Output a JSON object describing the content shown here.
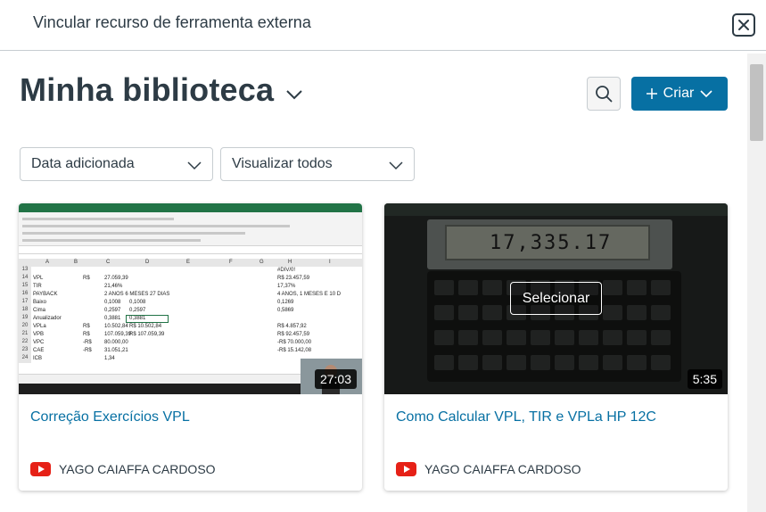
{
  "modal": {
    "title": "Vincular recurso de ferramenta externa",
    "close_icon": "close-icon"
  },
  "library": {
    "title": "Minha biblioteca",
    "chevron_icon": "chevron-down-icon"
  },
  "toolbar": {
    "search_icon": "search-icon",
    "create_label": "Criar",
    "create_icon": "plus-icon"
  },
  "filters": {
    "sort_selected": "Data adicionada",
    "view_selected": "Visualizar todos"
  },
  "colors": {
    "accent": "#0770a3",
    "text": "#2d3b45",
    "youtube": "#e62117"
  },
  "videos": [
    {
      "title": "Correção Exercícios VPL",
      "duration": "27:03",
      "channel": "YAGO CAIAFFA CARDOSO",
      "channel_icon": "youtube-icon",
      "thumbnail": {
        "rows": [
          {
            "n": "13",
            "a": "",
            "b": "",
            "c": "",
            "d": "",
            "h": "#DIV/0!"
          },
          {
            "n": "14",
            "a": "VPL",
            "b": "R$",
            "c": "27.059,39",
            "d": "",
            "h": "R$ 23.457,59"
          },
          {
            "n": "15",
            "a": "TIR",
            "b": "",
            "c": "21,46%",
            "d": "",
            "h": "17,37%"
          },
          {
            "n": "16",
            "a": "PAYBACK",
            "b": "",
            "c": "2 ANOS 6 MESES 27 DIAS",
            "d": "",
            "h": "4 ANOS, 1 MESES E 10 D"
          },
          {
            "n": "17",
            "a": "Baixo",
            "b": "",
            "c": "0,1008",
            "d": "0,1008",
            "h": "0,1269"
          },
          {
            "n": "18",
            "a": "Cima",
            "b": "",
            "c": "0,2597",
            "d": "0,2597",
            "h": "0,5869"
          },
          {
            "n": "19",
            "a": "Anualizador",
            "b": "",
            "c": "0,3881",
            "d": "0,3881",
            "h": ""
          },
          {
            "n": "20",
            "a": "VPLa",
            "b": "R$",
            "c": "10.502,84",
            "d": "R$ 10.502,84",
            "h": "R$ 4.857,92"
          },
          {
            "n": "21",
            "a": "VPB",
            "b": "R$",
            "c": "107.059,39",
            "d": "R$ 107.059,39",
            "h": "R$ 92.457,59"
          },
          {
            "n": "22",
            "a": "VPC",
            "b": "-R$",
            "c": "80.000,00",
            "d": "",
            "h": "-R$ 70.000,00"
          },
          {
            "n": "23",
            "a": "CAE",
            "b": "-R$",
            "c": "31.051,21",
            "d": "",
            "h": "-R$ 15.142,08"
          },
          {
            "n": "24",
            "a": "ICB",
            "b": "",
            "c": "1,34",
            "d": "",
            "h": ""
          }
        ],
        "columns": [
          "A",
          "B",
          "C",
          "D",
          "E",
          "F",
          "G",
          "H",
          "I"
        ]
      }
    },
    {
      "title": "Como Calcular VPL, TIR e VPLa HP 12C",
      "duration": "5:35",
      "channel": "YAGO CAIAFFA CARDOSO",
      "channel_icon": "youtube-icon",
      "hover_label": "Selecionar",
      "thumbnail": {
        "display_value": "17,335.17"
      }
    }
  ]
}
